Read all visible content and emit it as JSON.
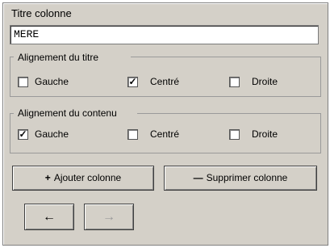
{
  "title_field": {
    "label": "Titre colonne",
    "value": "MERE"
  },
  "title_alignment": {
    "legend": "Alignement du titre",
    "options": [
      {
        "label": "Gauche",
        "checked": false
      },
      {
        "label": "Centré",
        "checked": true
      },
      {
        "label": "Droite",
        "checked": false
      }
    ]
  },
  "content_alignment": {
    "legend": "Alignement du contenu",
    "options": [
      {
        "label": "Gauche",
        "checked": true
      },
      {
        "label": "Centré",
        "checked": false
      },
      {
        "label": "Droite",
        "checked": false
      }
    ]
  },
  "buttons": {
    "add_label": "Ajouter colonne",
    "add_icon": "+",
    "remove_label": "Supprimer colonne",
    "remove_icon": "—",
    "prev_icon": "←",
    "next_icon": "→",
    "next_enabled": false
  },
  "colors": {
    "panel_bg": "#d4d0c8",
    "check_mark": "#000000"
  }
}
